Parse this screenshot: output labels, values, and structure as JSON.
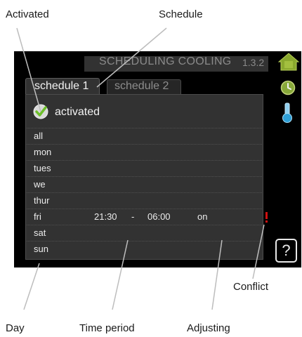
{
  "callouts": {
    "activated": "Activated",
    "schedule": "Schedule",
    "conflict": "Conflict",
    "day": "Day",
    "time_period": "Time period",
    "adjusting": "Adjusting"
  },
  "screen": {
    "title": "SCHEDULING COOLING",
    "menu_id": "1.3.2",
    "tabs": [
      {
        "label": "schedule 1",
        "active": true
      },
      {
        "label": "schedule 2",
        "active": false
      }
    ],
    "activated": {
      "label": "activated",
      "checked": true
    },
    "days": [
      {
        "day": "all",
        "start": "",
        "sep": "",
        "end": "",
        "mode": ""
      },
      {
        "day": "mon",
        "start": "",
        "sep": "",
        "end": "",
        "mode": ""
      },
      {
        "day": "tues",
        "start": "",
        "sep": "",
        "end": "",
        "mode": ""
      },
      {
        "day": "we",
        "start": "",
        "sep": "",
        "end": "",
        "mode": ""
      },
      {
        "day": "thur",
        "start": "",
        "sep": "",
        "end": "",
        "mode": ""
      },
      {
        "day": "fri",
        "start": "21:30",
        "sep": "-",
        "end": "06:00",
        "mode": "on"
      },
      {
        "day": "sat",
        "start": "",
        "sep": "",
        "end": "",
        "mode": ""
      },
      {
        "day": "sun",
        "start": "",
        "sep": "",
        "end": "",
        "mode": ""
      }
    ],
    "help_glyph": "?",
    "icons": [
      "house-icon",
      "clock-icon",
      "thermometer-icon",
      "warning-icon",
      "help-icon"
    ],
    "colors": {
      "house": "#8aa82e",
      "clock": "#88a83a",
      "thermo": "#2e9fd6",
      "check": "#6cbf2a",
      "conflict": "#d01010"
    }
  }
}
